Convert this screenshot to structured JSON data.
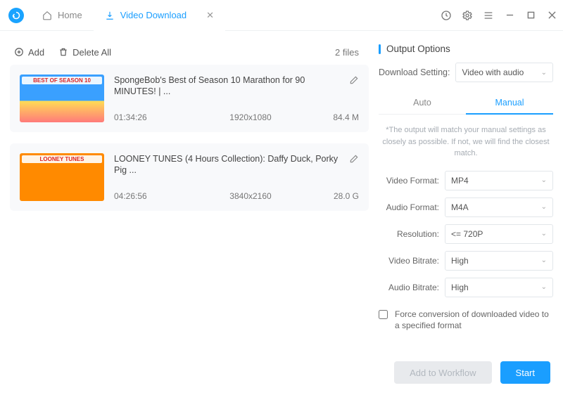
{
  "tabs": {
    "home": "Home",
    "download": "Video Download"
  },
  "actions": {
    "add": "Add",
    "delete_all": "Delete All"
  },
  "files_count": "2 files",
  "videos": [
    {
      "title": "SpongeBob's Best of Season 10 Marathon for 90 MINUTES! | ...",
      "duration": "01:34:26",
      "resolution": "1920x1080",
      "size": "84.4 M",
      "thumb_badge": "BEST OF SEASON 10"
    },
    {
      "title": "LOONEY TUNES (4 Hours Collection): Daffy Duck, Porky Pig ...",
      "duration": "04:26:56",
      "resolution": "3840x2160",
      "size": "28.0 G",
      "thumb_badge": "LOONEY TUNES"
    }
  ],
  "output": {
    "heading": "Output Options",
    "setting_label": "Download Setting:",
    "setting_value": "Video with audio",
    "tab_auto": "Auto",
    "tab_manual": "Manual",
    "note": "*The output will match your manual settings as closely as possible. If not, we will find the closest match.",
    "video_format_label": "Video Format:",
    "video_format_value": "MP4",
    "audio_format_label": "Audio Format:",
    "audio_format_value": "M4A",
    "resolution_label": "Resolution:",
    "resolution_value": "<= 720P",
    "video_bitrate_label": "Video Bitrate:",
    "video_bitrate_value": "High",
    "audio_bitrate_label": "Audio Bitrate:",
    "audio_bitrate_value": "High",
    "force_label": "Force conversion of downloaded video to a specified format"
  },
  "footer": {
    "workflow": "Add to Workflow",
    "start": "Start"
  }
}
